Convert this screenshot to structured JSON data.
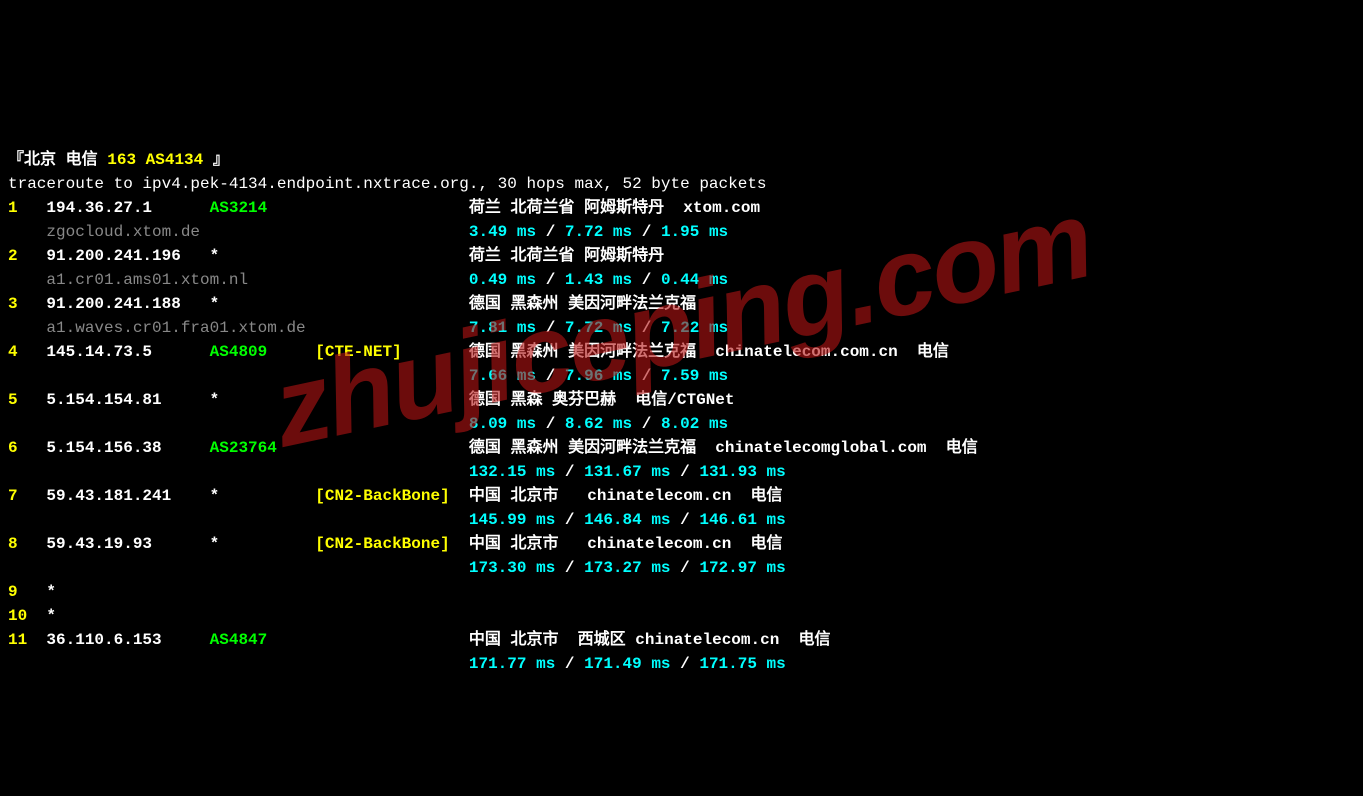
{
  "header": {
    "bracket_open": "『",
    "location": "北京 电信",
    "isp_num": "163",
    "asn": "AS4134",
    "bracket_close": "』"
  },
  "traceroute_line": "traceroute to ipv4.pek-4134.endpoint.nxtrace.org., 30 hops max, 52 byte packets",
  "hops": [
    {
      "num": "1",
      "ip": "194.36.27.1",
      "asn": "AS3214",
      "net": "",
      "location": "荷兰 北荷兰省 阿姆斯特丹  xtom.com",
      "hostname": "zgocloud.xtom.de",
      "latency": [
        "3.49 ms",
        "7.72 ms",
        "1.95 ms"
      ]
    },
    {
      "num": "2",
      "ip": "91.200.241.196",
      "asn": "*",
      "net": "",
      "location": "荷兰 北荷兰省 阿姆斯特丹",
      "hostname": "a1.cr01.ams01.xtom.nl",
      "latency": [
        "0.49 ms",
        "1.43 ms",
        "0.44 ms"
      ]
    },
    {
      "num": "3",
      "ip": "91.200.241.188",
      "asn": "*",
      "net": "",
      "location": "德国 黑森州 美因河畔法兰克福",
      "hostname": "a1.waves.cr01.fra01.xtom.de",
      "latency": [
        "7.81 ms",
        "7.72 ms",
        "7.22 ms"
      ]
    },
    {
      "num": "4",
      "ip": "145.14.73.5",
      "asn": "AS4809",
      "net": "[CTE-NET]",
      "location": "德国 黑森州 美因河畔法兰克福  chinatelecom.com.cn  电信",
      "hostname": "",
      "latency": [
        "7.66 ms",
        "7.96 ms",
        "7.59 ms"
      ]
    },
    {
      "num": "5",
      "ip": "5.154.154.81",
      "asn": "*",
      "net": "",
      "location": "德国 黑森 奥芬巴赫  电信/CTGNet",
      "hostname": "",
      "latency": [
        "8.09 ms",
        "8.62 ms",
        "8.02 ms"
      ]
    },
    {
      "num": "6",
      "ip": "5.154.156.38",
      "asn": "AS23764",
      "net": "",
      "location": "德国 黑森州 美因河畔法兰克福  chinatelecomglobal.com  电信",
      "hostname": "",
      "latency": [
        "132.15 ms",
        "131.67 ms",
        "131.93 ms"
      ]
    },
    {
      "num": "7",
      "ip": "59.43.181.241",
      "asn": "*",
      "net": "[CN2-BackBone]",
      "location": "中国 北京市   chinatelecom.cn  电信",
      "hostname": "",
      "latency": [
        "145.99 ms",
        "146.84 ms",
        "146.61 ms"
      ]
    },
    {
      "num": "8",
      "ip": "59.43.19.93",
      "asn": "*",
      "net": "[CN2-BackBone]",
      "location": "中国 北京市   chinatelecom.cn  电信",
      "hostname": "",
      "latency": [
        "173.30 ms",
        "173.27 ms",
        "172.97 ms"
      ]
    },
    {
      "num": "9",
      "ip": "*",
      "asn": "",
      "net": "",
      "location": "",
      "hostname": "",
      "latency": []
    },
    {
      "num": "10",
      "ip": "*",
      "asn": "",
      "net": "",
      "location": "",
      "hostname": "",
      "latency": []
    },
    {
      "num": "11",
      "ip": "36.110.6.153",
      "asn": "AS4847",
      "net": "",
      "location": "中国 北京市  西城区 chinatelecom.cn  电信",
      "hostname": "",
      "latency": [
        "171.77 ms",
        "171.49 ms",
        "171.75 ms"
      ]
    }
  ],
  "watermark": "zhujiceping.com",
  "separator": " / "
}
